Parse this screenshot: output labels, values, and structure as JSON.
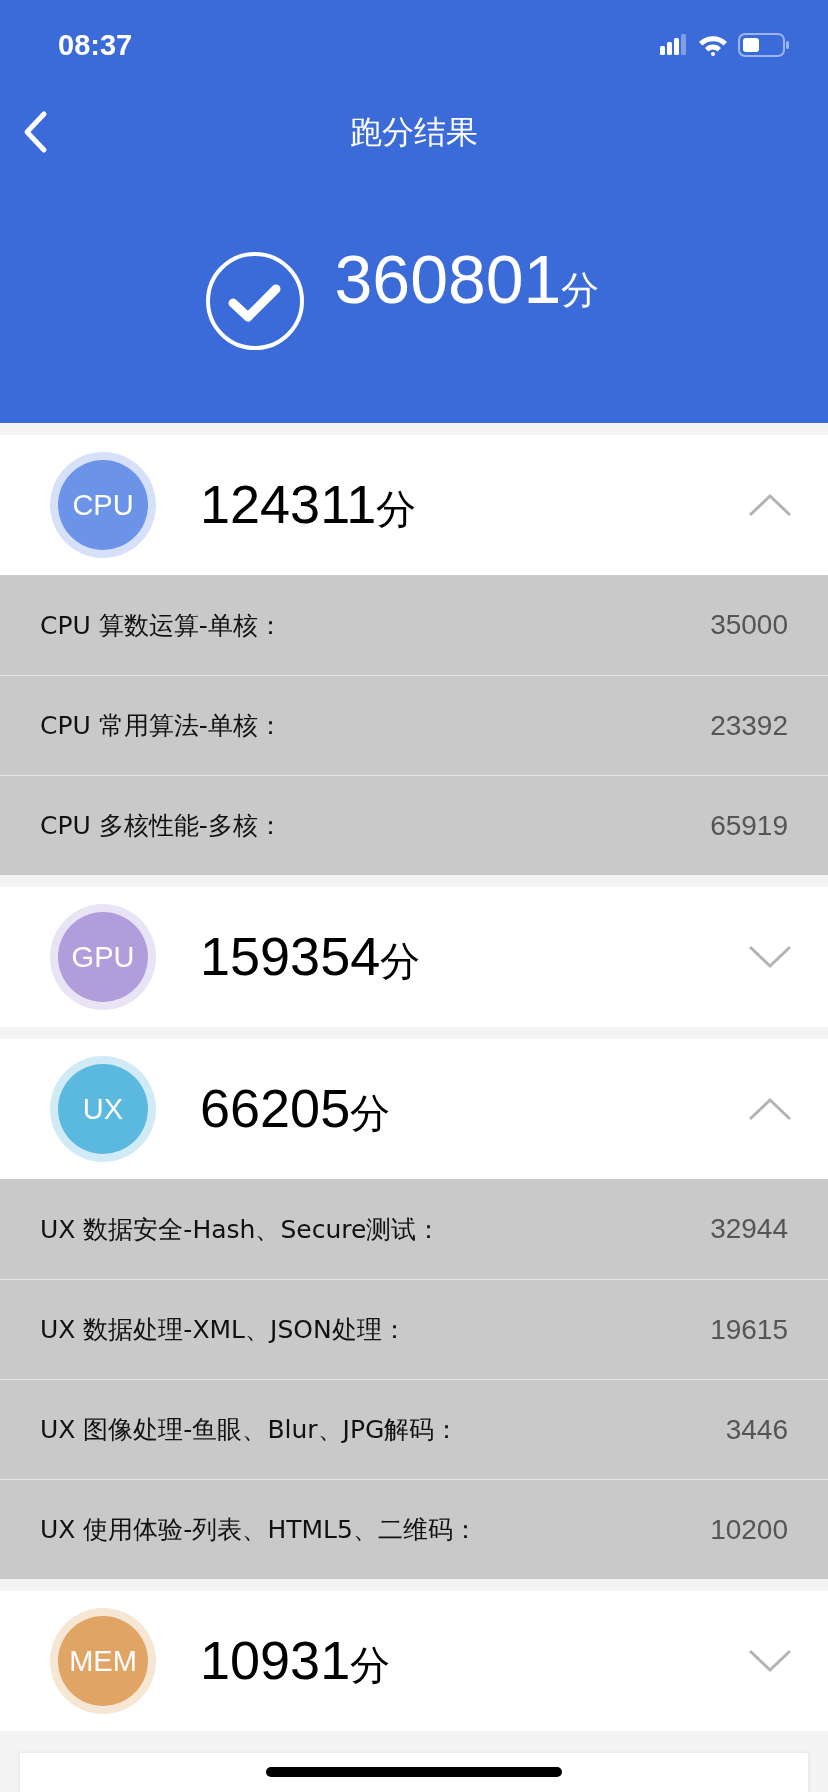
{
  "status_bar": {
    "time": "08:37"
  },
  "header": {
    "title": "跑分结果"
  },
  "total": {
    "score": "360801",
    "unit": "分"
  },
  "categories": [
    {
      "label": "CPU",
      "score": "124311",
      "unit": "分",
      "color": "#6b93e8",
      "expanded": true,
      "items": [
        {
          "label": "CPU 算数运算-单核：",
          "value": "35000"
        },
        {
          "label": "CPU 常用算法-单核：",
          "value": "23392"
        },
        {
          "label": "CPU 多核性能-多核：",
          "value": "65919"
        }
      ]
    },
    {
      "label": "GPU",
      "score": "159354",
      "unit": "分",
      "color": "#b09ddb",
      "expanded": false
    },
    {
      "label": "UX",
      "score": "66205",
      "unit": "分",
      "color": "#5bb8de",
      "expanded": true,
      "items": [
        {
          "label": "UX 数据安全-Hash、Secure测试：",
          "value": "32944"
        },
        {
          "label": "UX 数据处理-XML、JSON处理：",
          "value": "19615"
        },
        {
          "label": "UX 图像处理-鱼眼、Blur、JPG解码：",
          "value": "3446"
        },
        {
          "label": "UX 使用体验-列表、HTML5、二维码：",
          "value": "10200"
        }
      ]
    },
    {
      "label": "MEM",
      "score": "10931",
      "unit": "分",
      "color": "#e0a465",
      "expanded": false
    }
  ]
}
